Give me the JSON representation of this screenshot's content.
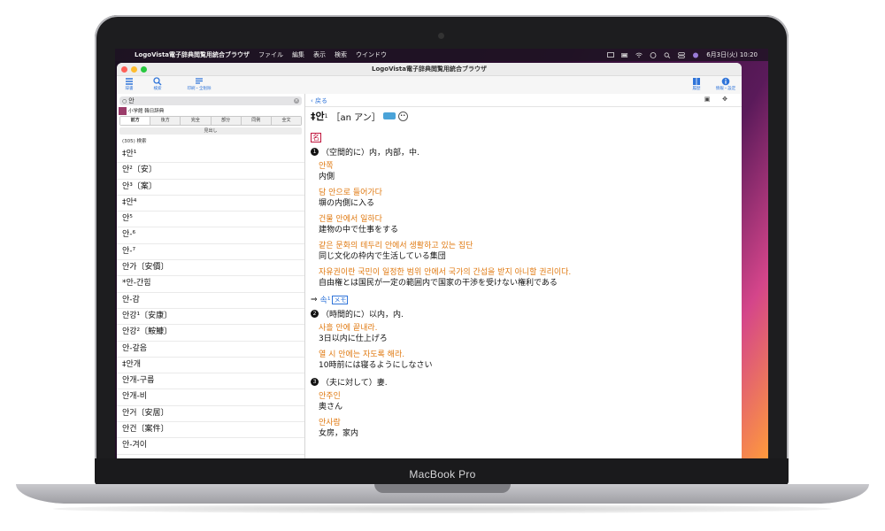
{
  "menubar": {
    "app_name": "LogoVista電子辞典閲覧用統合ブラウザ",
    "menus": [
      "ファイル",
      "編集",
      "表示",
      "検索",
      "ウインドウ"
    ],
    "clock": "6月3日(火) 10:20"
  },
  "window": {
    "title": "LogoVista電子辞典閲覧用統合ブラウザ",
    "toolbar": {
      "list_label": "辞書",
      "search_label": "検索",
      "history_label": "印刷・全削除",
      "bookmark_label": "履歴",
      "info_label": "情報・設定"
    }
  },
  "sidebar": {
    "search_value": "안",
    "dictionary_name": "小学館 韓日辞典",
    "modes": [
      "前方",
      "後方",
      "完全",
      "部分",
      "同例",
      "全文"
    ],
    "active_mode": "前方",
    "midashi_label": "見出し",
    "result_count": "(305) 検索",
    "results": [
      "‡안¹",
      "안²〔安〕",
      "안³〔案〕",
      "‡안⁴",
      "안⁵",
      "안-⁶",
      "안-⁷",
      "안가〔安價〕",
      "*안-간힘",
      "안-감",
      "안강¹〔安康〕",
      "안강²〔鮟鱇〕",
      "안-갚음",
      "‡안개",
      "안개-구름",
      "안개-비",
      "안거〔安居〕",
      "안건〔案件〕",
      "안-겨이"
    ]
  },
  "detail": {
    "back_label": "戻る",
    "headword": "‡안",
    "headword_sup": "1",
    "pronunciation": "［an アン］",
    "part_of_speech": "名",
    "sense1": {
      "num": "1",
      "definition": "（空間的に）内，内部，中."
    },
    "examples1": [
      {
        "ko": "안쪽",
        "ja": "内側"
      },
      {
        "ko": "담 안으로 들어가다",
        "ja": "塀の内側に入る"
      },
      {
        "ko": "건물 안에서 일하다",
        "ja": "建物の中で仕事をする"
      },
      {
        "ko": "같은 문화의 테두리 안에서 생활하고 있는 집단",
        "ja": "同じ文化の枠内で生活している集団"
      },
      {
        "ko": "자유권이란 국민이 일정한 범위 안에서 국가의 간섭을 받지 아니할 권리이다.",
        "ja": "自由権とは国民が一定の範囲内で国家の干渉を受けない権利である"
      }
    ],
    "ref_arrow": "⇒",
    "ref_word": "속¹",
    "memo_label": "メモ",
    "sense2": {
      "num": "2",
      "definition": "（時間的に）以内，内."
    },
    "examples2": [
      {
        "ko": "사흘 안에 끝내라.",
        "ja": "3日以内に仕上げろ"
      },
      {
        "ko": "열 시 안에는 자도록 해라.",
        "ja": "10時前には寝るようにしなさい"
      }
    ],
    "sense3": {
      "num": "3",
      "definition": "（夫に対して）妻."
    },
    "examples3": [
      {
        "ko": "안주인",
        "ja": "奥さん"
      },
      {
        "ko": "안사람",
        "ja": "女房，家内"
      }
    ]
  },
  "laptop_brand": "MacBook Pro",
  "colors": {
    "accent": "#2f74d9",
    "example": "#e07a12",
    "pos": "#c0143c"
  }
}
